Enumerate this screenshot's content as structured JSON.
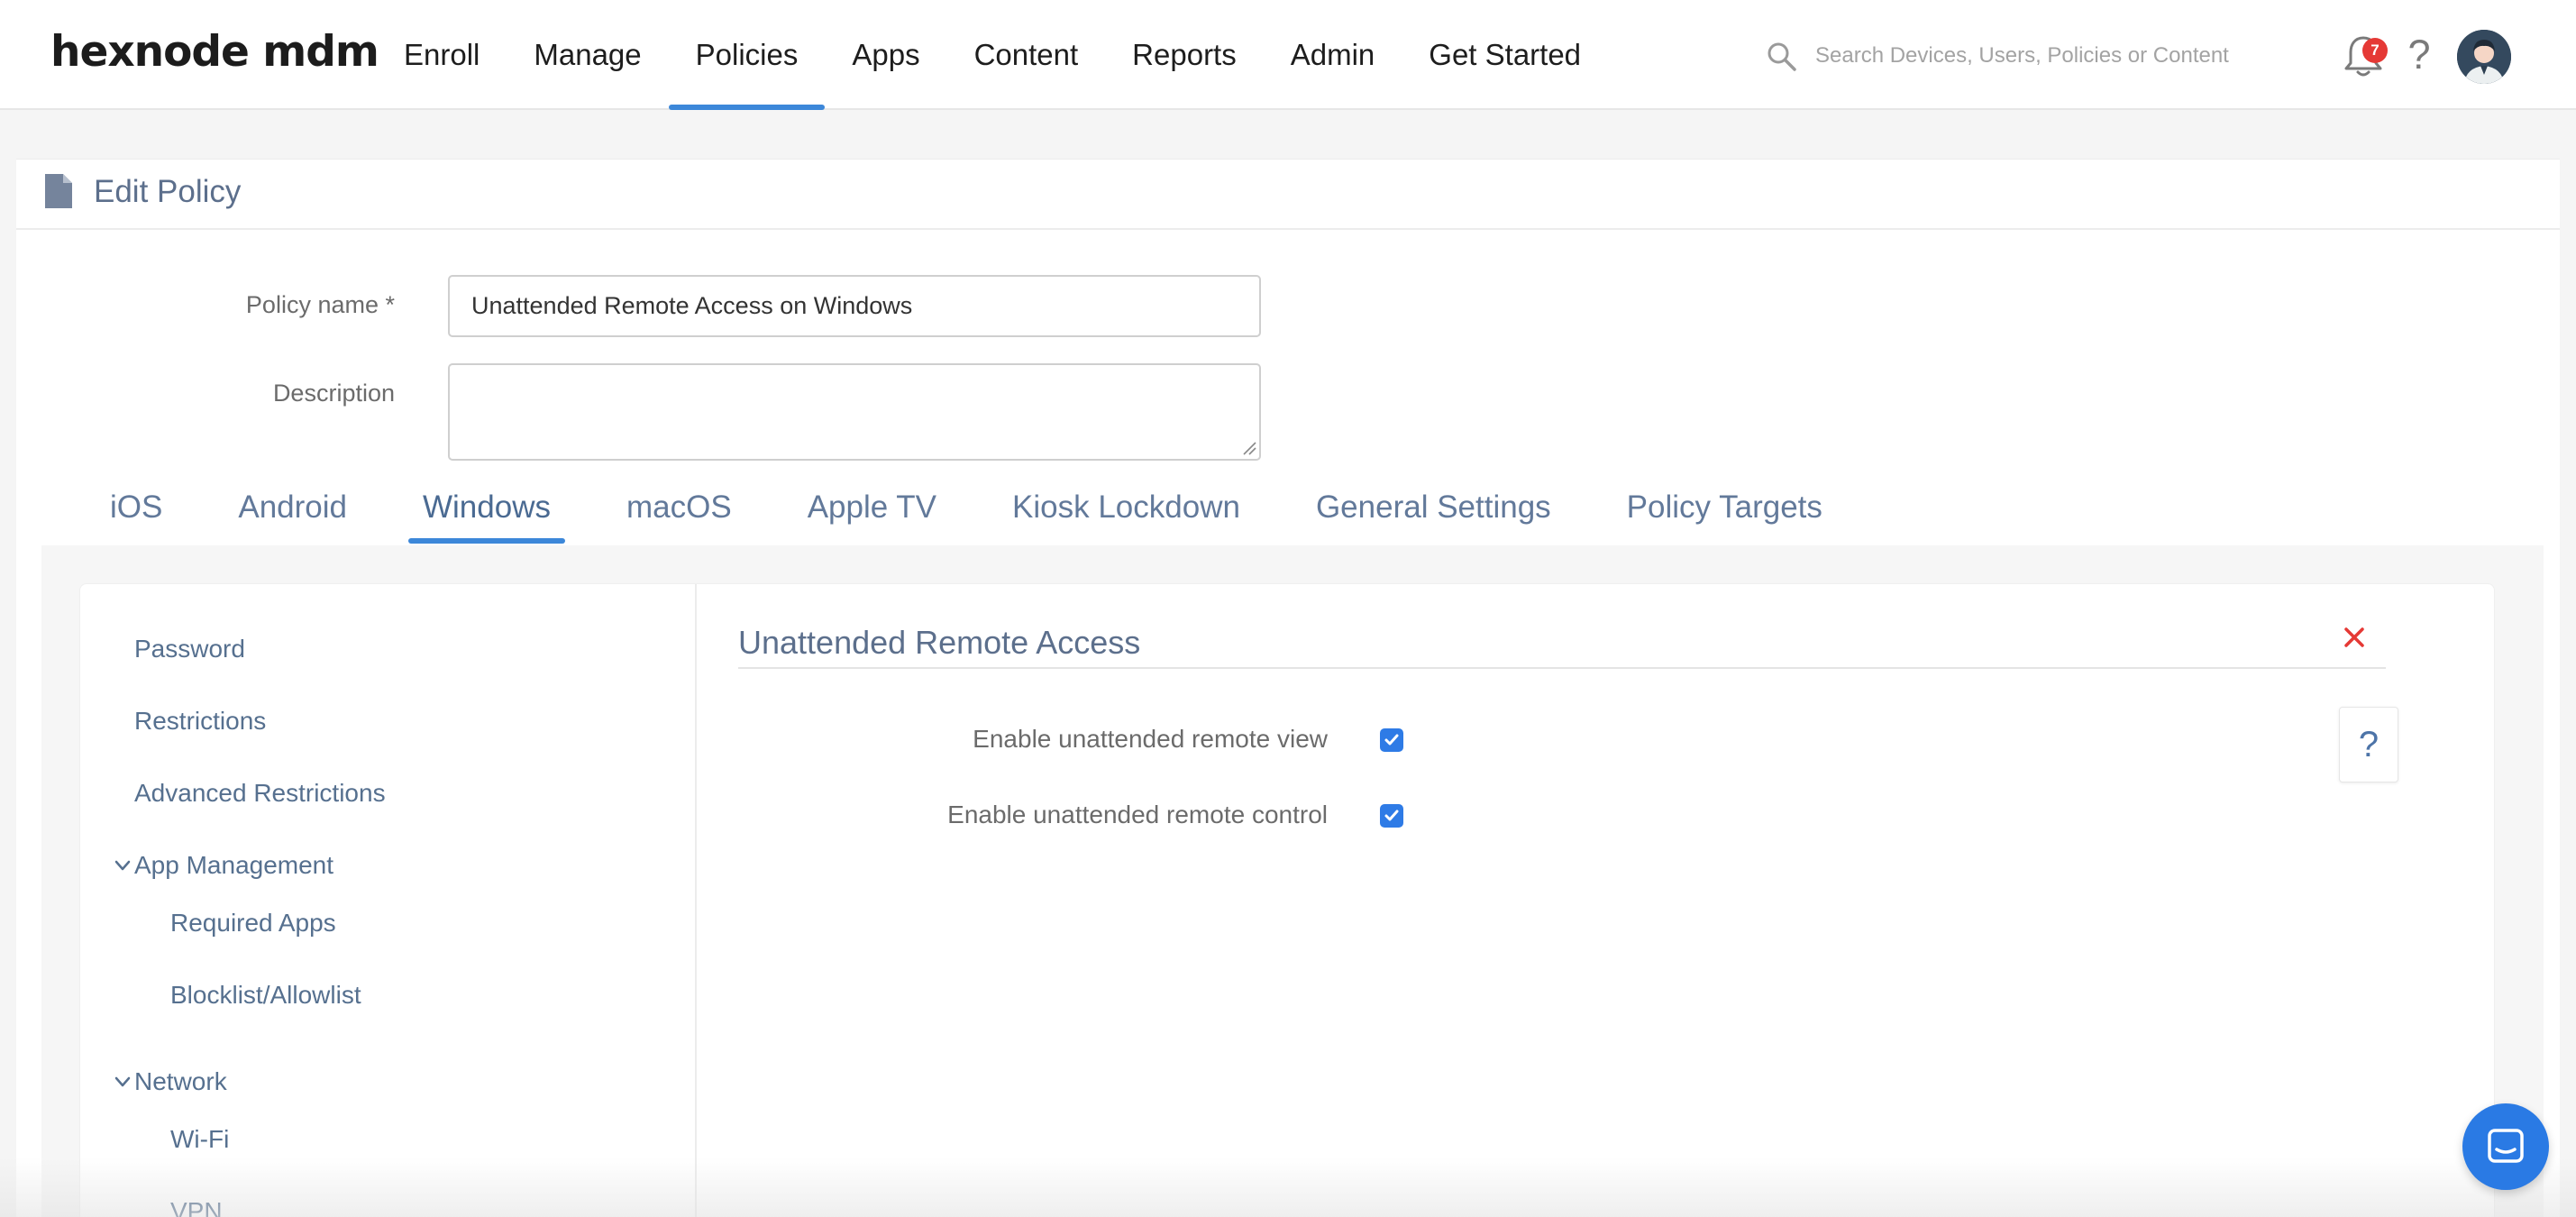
{
  "brand": {
    "logo_text": "hexnode mdm"
  },
  "nav": {
    "items": [
      {
        "label": "Enroll"
      },
      {
        "label": "Manage"
      },
      {
        "label": "Policies"
      },
      {
        "label": "Apps"
      },
      {
        "label": "Content"
      },
      {
        "label": "Reports"
      },
      {
        "label": "Admin"
      },
      {
        "label": "Get Started"
      }
    ],
    "active": "Policies"
  },
  "search": {
    "placeholder": "Search Devices, Users, Policies or Content"
  },
  "header_icons": {
    "notification_count": "7",
    "help_glyph": "?"
  },
  "page": {
    "title": "Edit Policy"
  },
  "form": {
    "policy_name_label": "Policy name *",
    "policy_name_value": "Unattended Remote Access on Windows",
    "description_label": "Description",
    "description_value": ""
  },
  "os_tabs": {
    "items": [
      {
        "label": "iOS"
      },
      {
        "label": "Android"
      },
      {
        "label": "Windows"
      },
      {
        "label": "macOS"
      },
      {
        "label": "Apple TV"
      },
      {
        "label": "Kiosk Lockdown"
      },
      {
        "label": "General Settings"
      },
      {
        "label": "Policy Targets"
      }
    ],
    "active": "Windows"
  },
  "sidebar": {
    "items": [
      {
        "label": "Password"
      },
      {
        "label": "Restrictions"
      },
      {
        "label": "Advanced Restrictions"
      },
      {
        "label": "App Management"
      },
      {
        "label": "Required Apps"
      },
      {
        "label": "Blocklist/Allowlist"
      },
      {
        "label": "Network"
      },
      {
        "label": "Wi-Fi"
      },
      {
        "label": "VPN"
      }
    ]
  },
  "section": {
    "title": "Unattended Remote Access",
    "help_glyph": "?",
    "options": [
      {
        "label": "Enable unattended remote view",
        "checked": true
      },
      {
        "label": "Enable unattended remote control",
        "checked": true
      }
    ]
  },
  "colors": {
    "accent": "#3c87d9",
    "checkbox": "#2e7be6",
    "close": "#e53935",
    "muted_blue_text": "#5c6f8c",
    "chat_button": "#2a7ae4"
  },
  "icons": [
    "search-icon",
    "bell-icon",
    "help-icon",
    "avatar",
    "document-icon",
    "chevron-down-icon",
    "close-icon",
    "checkmark-icon",
    "chat-icon"
  ]
}
